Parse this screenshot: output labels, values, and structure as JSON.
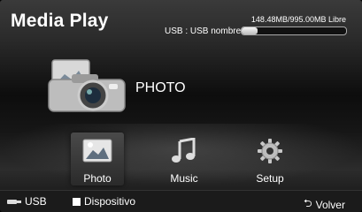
{
  "header": {
    "title": "Media Play",
    "usb_name": "USB : USB nombre",
    "usage_text": "148.48MB/995.00MB Libre",
    "usage_fraction": 0.149
  },
  "hero": {
    "label": "PHOTO",
    "icon": "camera-photo-icon"
  },
  "menu": {
    "items": [
      {
        "label": "Photo",
        "icon": "photo-icon",
        "selected": true
      },
      {
        "label": "Music",
        "icon": "music-note-icon",
        "selected": false
      },
      {
        "label": "Setup",
        "icon": "gear-icon",
        "selected": false
      }
    ]
  },
  "footer": {
    "usb_label": "USB",
    "device_label": "Dispositivo",
    "back_label": "Volver"
  },
  "colors": {
    "text": "#ffffff",
    "background": "#1a1a1a"
  }
}
